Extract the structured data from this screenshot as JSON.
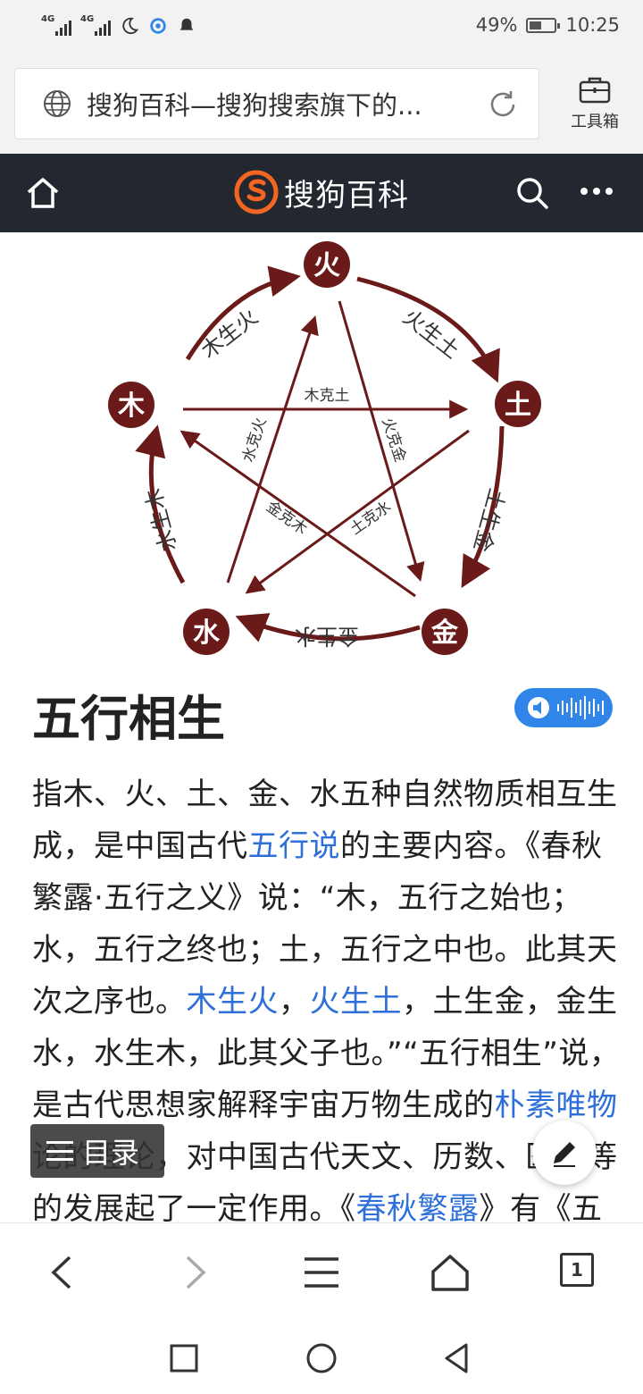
{
  "status_bar": {
    "network_1": "4G",
    "network_2": "4G",
    "battery_percent": 49,
    "battery_text": "49%",
    "time": "10:25",
    "icons": [
      "signal-icon",
      "signal-icon",
      "moon-icon",
      "location-icon",
      "notification-icon",
      "battery-icon"
    ]
  },
  "address_bar": {
    "url_text": "搜狗百科—搜狗搜索旗下的...",
    "toolbox_label": "工具箱"
  },
  "site_header": {
    "brand": "搜狗百科",
    "accent": "#f26522",
    "background": "#23272f"
  },
  "diagram": {
    "elements": {
      "fire": "火",
      "earth": "土",
      "metal": "金",
      "water": "水",
      "wood": "木"
    },
    "generating": {
      "wood_fire": "木生火",
      "fire_earth": "火生土",
      "earth_metal": "土生金",
      "metal_water": "金生水",
      "water_wood": "水生木"
    },
    "overcoming": {
      "wood_earth": "木克土",
      "fire_metal": "火克金",
      "water_fire": "水克火",
      "metal_wood": "金克木",
      "earth_water": "土克水"
    },
    "color": "#6b1a1a"
  },
  "article": {
    "title": "五行相生",
    "lines": [
      {
        "t1": "指木、火、土、金、水五种自然物质相互生"
      },
      {
        "t1": "成，是中国古代",
        "link1": "五行说",
        "t2": "的主要内容。《春秋"
      },
      {
        "t1": "繁露·五行之义》说：“木，五行之始也；"
      },
      {
        "t1": "水，五行之终也；土，五行之中也。此其天"
      },
      {
        "t1": "次之序也。",
        "link1": "木生火",
        "t2": "，",
        "link2": "火生土",
        "t3": "，土生金，金生"
      },
      {
        "t1": "水，水生木，此其父子也。”“五行相生”说，"
      },
      {
        "t1": "是古代思想家解释宇宙万物生成的",
        "link1": "朴素唯物"
      },
      {
        "t1": "论的理论，对中国古代天文、历数、医学等"
      },
      {
        "t1": "的发展起了一定作用。《",
        "link1": "春秋繁露",
        "t2": "》有《五"
      }
    ],
    "link_color": "#2e6fd9",
    "toc_label": "目录"
  },
  "bottom_bar": {
    "tab_count": "1"
  }
}
